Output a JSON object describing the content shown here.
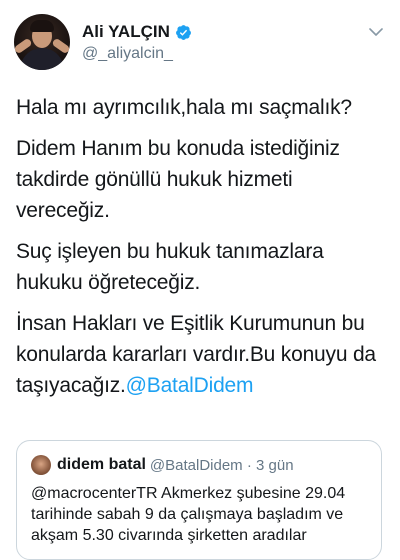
{
  "author": {
    "display_name": "Ali YALÇIN",
    "handle": "@_aliyalcin_"
  },
  "icons": {
    "verified": "verified-badge-icon",
    "more": "chevron-down-icon",
    "accent": "#1da1f2"
  },
  "tweet": {
    "p1": "Hala mı ayrımcılık,hala mı saçmalık?",
    "p2": "Didem Hanım bu konuda istediğiniz takdirde gönüllü hukuk hizmeti vereceğiz.",
    "p3": "Suç işleyen bu hukuk tanımazlara hukuku öğreteceğiz.",
    "p4_text": "İnsan Hakları ve Eşitlik Kurumunun bu konularda kararları vardır.Bu konuyu da taşıyacağız.",
    "p4_mention": "@BatalDidem"
  },
  "quoted": {
    "display_name": "didem batal",
    "meta": "@BatalDidem · 3 gün",
    "text": "@macrocenterTR Akmerkez şubesine 29.04 tarihinde sabah 9 da çalışmaya başladım ve akşam 5.30 civarında şirketten aradılar"
  }
}
